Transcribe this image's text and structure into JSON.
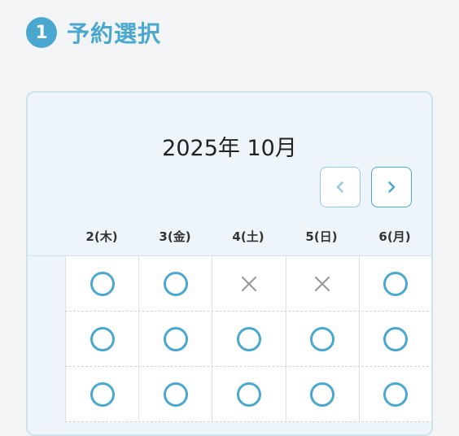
{
  "step": {
    "number": "1",
    "title": "予約選択"
  },
  "calendar": {
    "month_label": "2025年 10月",
    "prev_icon": "chevron-left-icon",
    "next_icon": "chevron-right-icon",
    "days": [
      "2(木)",
      "3(金)",
      "4(土)",
      "5(日)",
      "6(月)"
    ],
    "rows": [
      [
        "available",
        "available",
        "unavailable",
        "unavailable",
        "available"
      ],
      [
        "available",
        "available",
        "available",
        "available",
        "available"
      ],
      [
        "available",
        "available",
        "available",
        "available",
        "available"
      ]
    ]
  },
  "colors": {
    "accent": "#4aa8d0",
    "cross": "#9a9a9a",
    "background": "#f2f4f6"
  }
}
